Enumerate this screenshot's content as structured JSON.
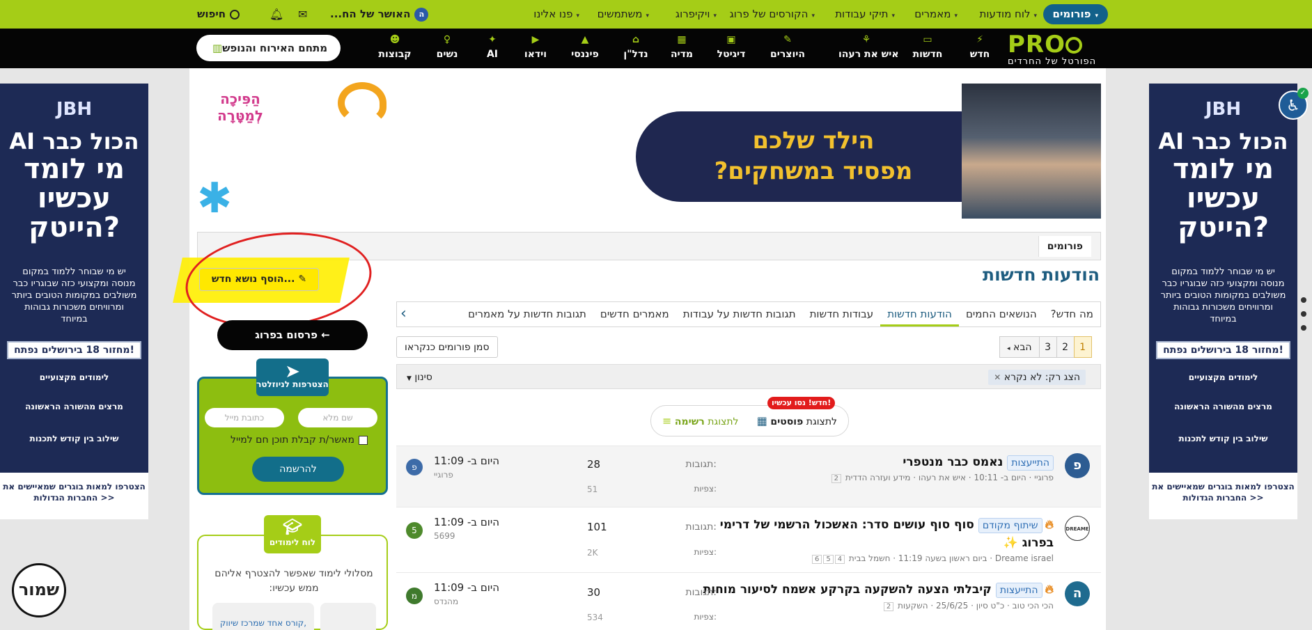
{
  "topbar": {
    "items": [
      {
        "label": "פורומים",
        "caret": "▾"
      },
      {
        "label": "לוח מודעות",
        "caret": "▾"
      },
      {
        "label": "מאמרים",
        "caret": "▾"
      },
      {
        "label": "תיקי עבודות",
        "caret": "▾"
      },
      {
        "label": "הקורסים של פרוג",
        "caret": "▾"
      },
      {
        "label": "ויקיפרוג",
        "caret": "▾"
      },
      {
        "label": "משתמשים",
        "caret": "▾"
      },
      {
        "label": "פנו אלינו",
        "caret": "▾"
      }
    ],
    "user_label": "האושר של הח...",
    "user_initial": "ה",
    "search_label": "חיפוש"
  },
  "navbar": {
    "logo": "PRO",
    "logo_sub": "הפורטל של החרדים",
    "items": [
      {
        "label": "חדש"
      },
      {
        "label": "חדשות"
      },
      {
        "label": "איש את רעהו"
      },
      {
        "label": "היוצרים"
      },
      {
        "label": "דיגיטל"
      },
      {
        "label": "מדיה"
      },
      {
        "label": "נדל\"ן"
      },
      {
        "label": "פיננסי"
      },
      {
        "label": "וידאו"
      },
      {
        "label": "AI"
      },
      {
        "label": "נשים"
      },
      {
        "label": "קבוצות"
      }
    ],
    "hosting_button": "מתחם האירוח והנופש"
  },
  "side_ads": {
    "brand": "JBH",
    "line1": "הכול כבר AI",
    "line2": "מי לומד",
    "line3": "עכשיו",
    "line4": "הייטק?",
    "body": "יש מי שבוחר ללמוד במקום מנוסה ומקצועי כזה שבוגריו כבר משולבים במקומות הטובים ביותר ומרוויחים משכורות גבוהות במיוחד",
    "cohort": "מחזור 18 בירושלים נפתח!",
    "features": [
      "לימודים מקצועיים",
      "מרצים מהשורה הראשונה",
      "שילוב בין קודש לתכנות"
    ],
    "cta": "הצטרפו למאות בוגרים שמאיישים את החברות הגדולות >>"
  },
  "banner": {
    "headline_1": "הילד שלכם",
    "headline_2": "מפסיד במשחקים?",
    "brand": "הַפִּיכָה לְמַטָּרָה"
  },
  "breadcrumb": {
    "item": "פורומים"
  },
  "page": {
    "title": "הודעות חדשות",
    "add_topic": "הוסף נושא חדש...",
    "promo_button": "פרסום בפרוג ←"
  },
  "tabs": [
    {
      "label": "מה חדש?",
      "active": false
    },
    {
      "label": "הנושאים החמים",
      "active": false
    },
    {
      "label": "הודעות חדשות",
      "active": true
    },
    {
      "label": "עבודות חדשות",
      "active": false
    },
    {
      "label": "תגובות חדשות על עבודות",
      "active": false
    },
    {
      "label": "מאמרים חדשים",
      "active": false
    },
    {
      "label": "תגובות חדשות על מאמרים",
      "active": false
    }
  ],
  "pager": {
    "pages": [
      "1",
      "2",
      "3"
    ],
    "current": "1",
    "next": "הבא"
  },
  "mark_read": "סמן פורומים כנקראו",
  "filter": {
    "chip_label": "הצג רק:",
    "chip_value": "לא נקרא",
    "button": "סינון"
  },
  "view_toggle": {
    "posts_label_a": "לתצוגת",
    "posts_label_b": "פוסטים",
    "list_label_a": "לתצוגת",
    "list_label_b": "רשימה",
    "new_badge": "חדש! נסו עכשיו!"
  },
  "threads": [
    {
      "tag": "התייעצות",
      "title": "נאמס כבר מנטפרי",
      "meta": "פרוגיי · היום ב- 10:11 · איש את רעהו · מידע ועזרה הדדית",
      "pages": [
        "2"
      ],
      "replies_label": "תגובות:",
      "replies": "28",
      "views_label": "צפיות:",
      "views": "51",
      "last_time": "היום ב- 11:09",
      "last_user": "פרוגיי",
      "avatar": "פ",
      "avatar_color": "#2d5c92",
      "small_avatar": "פ",
      "small_color": "#3d6ba8"
    },
    {
      "tag": "שיתוף מקודם",
      "title": "סוף סוף עושים סדר: האשכול הרשמי של דרימי בפרוג ✨",
      "meta": "Dreame israel · ביום ראשון בשעה 11:19 · חשמל בבית",
      "pages": [
        "4",
        "5",
        "6"
      ],
      "replies_label": "תגובות:",
      "replies": "101",
      "views_label": "צפיות:",
      "views": "2K",
      "last_time": "היום ב- 11:09",
      "last_user": "5699",
      "avatar": "DREAME",
      "avatar_color": "#ffffff",
      "small_avatar": "5",
      "small_color": "#4e8a2c"
    },
    {
      "tag": "התייעצות",
      "title": "קיבלתי הצעה להשקעה בקרקע אשמח לסיעור מוחות",
      "meta": "הכי הכי טוב · כ\"ט סיון · 25/6/25 · השקעות",
      "pages": [
        "2"
      ],
      "replies_label": "תגובות:",
      "replies": "30",
      "views_label": "צפיות:",
      "views": "534",
      "last_time": "היום ב- 11:09",
      "last_user": "מהנדס",
      "avatar": "ה",
      "avatar_color": "#1f6b8f",
      "small_avatar": "מ",
      "small_color": "#3f7a2d"
    }
  ],
  "newsletter": {
    "title": "הצטרפות לניוזלטר",
    "name_placeholder": "שם מלא",
    "email_placeholder": "כתובת מייל",
    "consent": "מאשר/ת קבלת תוכן חם למייל",
    "submit": "להרשמה"
  },
  "study": {
    "title": "לוח לימודים",
    "text": "מסלולי לימוד שאפשר להצטרף אליהם ממש עכשיו:",
    "card": "קורס אחד שמרכז שיווק,"
  },
  "shamor": "שמור",
  "colors": {
    "brand_green": "#a5cd17",
    "brand_blue": "#12618a",
    "nav_black": "#050505"
  }
}
